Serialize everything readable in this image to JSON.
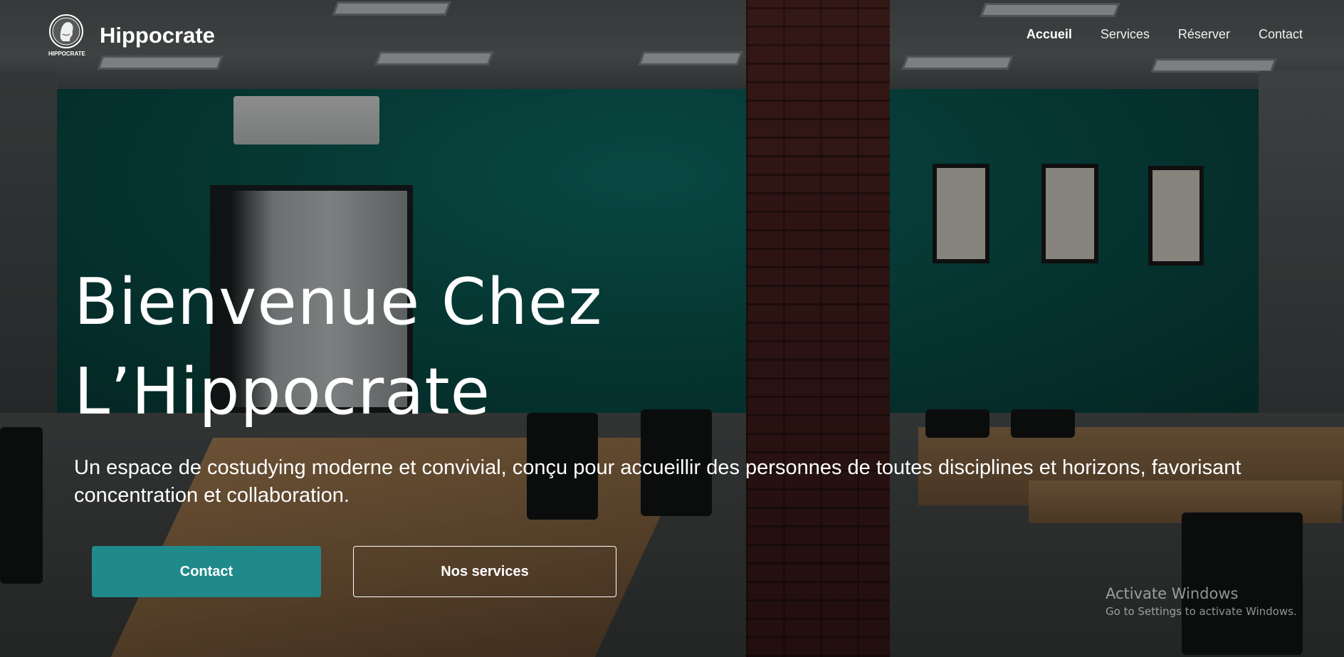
{
  "brand": {
    "name": "Hippocrate",
    "logo_text": "HIPPOCRATE"
  },
  "nav": {
    "items": [
      {
        "label": "Accueil",
        "active": true
      },
      {
        "label": "Services",
        "active": false
      },
      {
        "label": "Réserver",
        "active": false
      },
      {
        "label": "Contact",
        "active": false
      }
    ]
  },
  "hero": {
    "title_line1": "Bienvenue Chez",
    "title_line2": "L’Hippocrate",
    "subtitle": "Un espace de costudying moderne et convivial, conçu pour accueillir des personnes de toutes disciplines et horizons, favorisant concentration et collaboration.",
    "buttons": {
      "contact_label": "Contact",
      "services_label": "Nos services"
    }
  },
  "watermark": {
    "title": "Activate Windows",
    "subtitle": "Go to Settings to activate Windows."
  },
  "colors": {
    "accent": "#1f8a89",
    "wall": "#0b5f58",
    "brick": "#4a2220"
  }
}
